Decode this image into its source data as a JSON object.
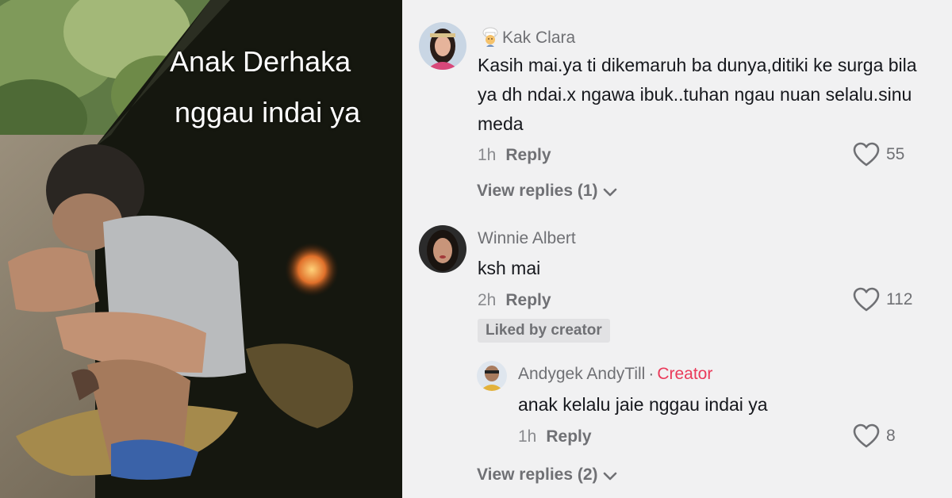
{
  "video": {
    "caption_line1": "Anak Derhaka",
    "caption_line2": "nggau indai ya"
  },
  "comments": [
    {
      "username": "Kak Clara",
      "badge_icon": "chef-emoji-icon",
      "text": "Kasih mai.ya ti dikemaruh ba dunya,ditiki ke surga bila ya dh ndai.x ngawa ibuk..tuhan ngau nuan selalu.sinu meda",
      "time": "1h",
      "reply_label": "Reply",
      "likes": "55",
      "view_replies": "View replies (1)"
    },
    {
      "username": "Winnie Albert",
      "text": "ksh mai",
      "time": "2h",
      "reply_label": "Reply",
      "likes": "112",
      "liked_by": "Liked by creator",
      "replies": [
        {
          "username": "Andygek AndyTill",
          "separator": "·",
          "role": "Creator",
          "text": "anak kelalu jaie nggau indai ya",
          "time": "1h",
          "reply_label": "Reply",
          "likes": "8"
        }
      ],
      "view_replies": "View replies (2)"
    }
  ],
  "colors": {
    "background": "#f1f1f2",
    "text_primary": "#16181d",
    "text_secondary": "#6f7074",
    "creator_accent": "#ea3a5a"
  }
}
